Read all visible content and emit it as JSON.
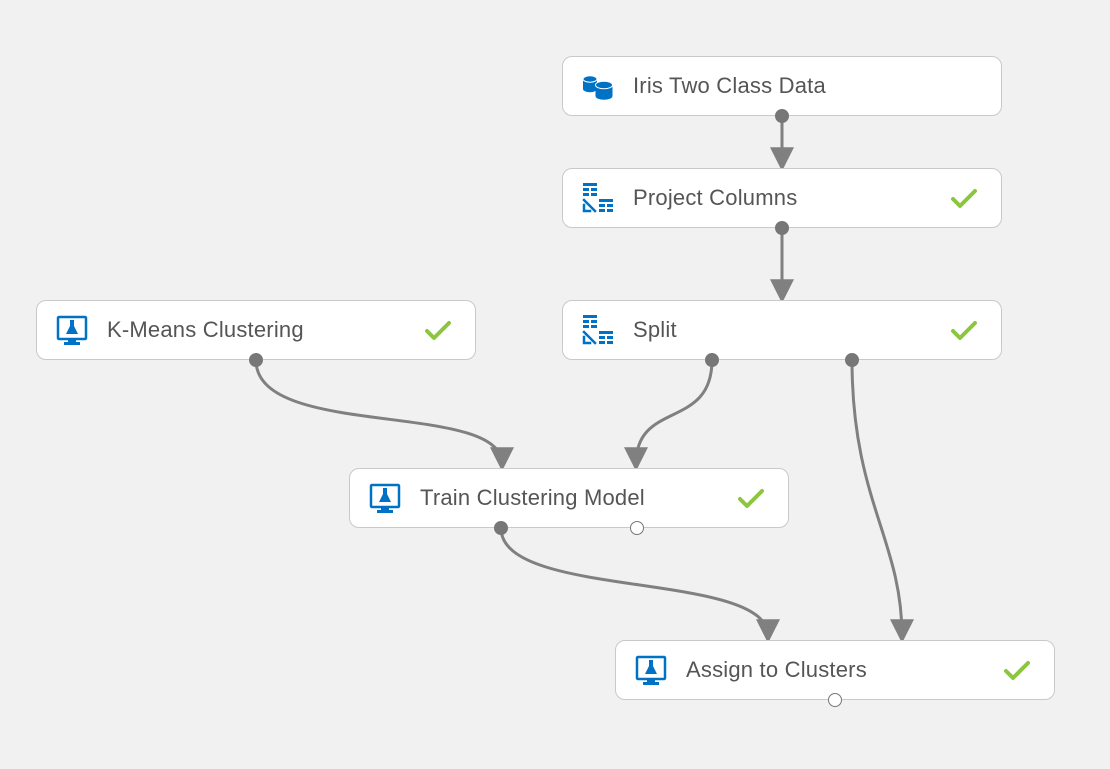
{
  "nodes": {
    "iris": {
      "label": "Iris Two Class Data",
      "icon": "dataset-icon",
      "status": "ok"
    },
    "project": {
      "label": "Project Columns",
      "icon": "columns-icon",
      "status": "ok"
    },
    "kmeans": {
      "label": "K-Means Clustering",
      "icon": "experiment-icon",
      "status": "ok"
    },
    "split": {
      "label": "Split",
      "icon": "columns-icon",
      "status": "ok"
    },
    "train": {
      "label": "Train Clustering Model",
      "icon": "experiment-icon",
      "status": "ok"
    },
    "assign": {
      "label": "Assign to Clusters",
      "icon": "experiment-icon",
      "status": "ok"
    }
  },
  "colors": {
    "icon_blue": "#0072c6",
    "check_green": "#8cc63f",
    "connector": "#808080",
    "port_fill": "#777777"
  }
}
